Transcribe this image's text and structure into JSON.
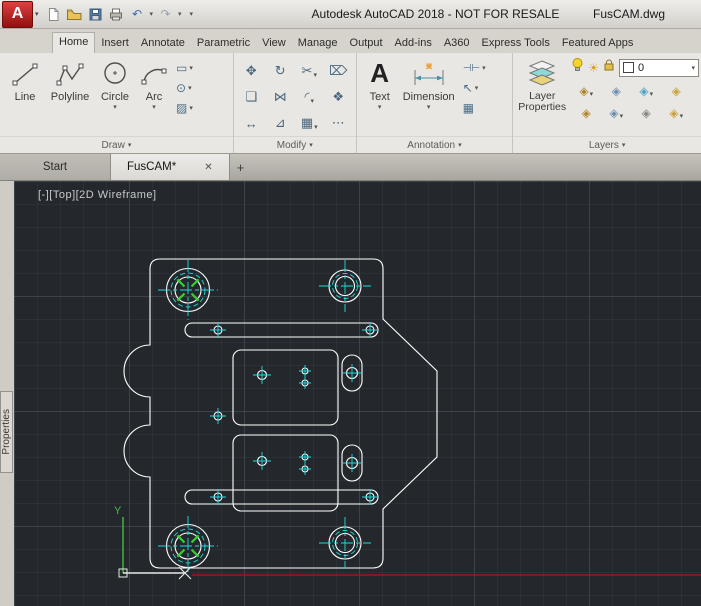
{
  "titlebar": {
    "title": "Autodesk AutoCAD 2018 - NOT FOR RESALE",
    "doc": "FusCAM.dwg",
    "logo_letter": "A"
  },
  "icons": {
    "chevron_down": "▾",
    "close": "✕",
    "sun": "☀",
    "undo": "↶",
    "redo": "↷",
    "text_tool_letter": "A",
    "rectangle_tool": "▭",
    "ellipse_tool": "⊙",
    "hatch_tool": "▨",
    "linear_dim_tool": "⊣⊢",
    "leader_tool": "↖",
    "table_tool": "▦"
  },
  "ribbon": {
    "tabs": [
      {
        "label": "Home",
        "active": true
      },
      {
        "label": "Insert"
      },
      {
        "label": "Annotate"
      },
      {
        "label": "Parametric"
      },
      {
        "label": "View"
      },
      {
        "label": "Manage"
      },
      {
        "label": "Output"
      },
      {
        "label": "Add-ins"
      },
      {
        "label": "A360"
      },
      {
        "label": "Express Tools"
      },
      {
        "label": "Featured Apps"
      }
    ],
    "draw": {
      "title": "Draw",
      "line_label": "Line",
      "polyline_label": "Polyline",
      "circle_label": "Circle",
      "arc_label": "Arc"
    },
    "modify": {
      "title": "Modify",
      "icons": [
        {
          "name": "move-icon",
          "glyph": "✥"
        },
        {
          "name": "rotate-icon",
          "glyph": "↻"
        },
        {
          "name": "trim-icon",
          "glyph": "✂"
        },
        {
          "name": "erase-icon",
          "glyph": "⌦"
        },
        {
          "name": "copy-icon",
          "glyph": "❏"
        },
        {
          "name": "mirror-icon",
          "glyph": "⋈"
        },
        {
          "name": "fillet-icon",
          "glyph": "◜"
        },
        {
          "name": "explode-icon",
          "glyph": "❖"
        },
        {
          "name": "stretch-icon",
          "glyph": "↔"
        },
        {
          "name": "scale-icon",
          "glyph": "⊿"
        },
        {
          "name": "array-icon",
          "glyph": "▦"
        },
        {
          "name": "more-icon",
          "glyph": "⋯"
        }
      ]
    },
    "annotation": {
      "title": "Annotation",
      "text_label": "Text",
      "dimension_label": "Dimension"
    },
    "layers": {
      "title": "Layers",
      "layer_properties_label": "Layer Properties",
      "current_layer": "0",
      "tool_icons": [
        {
          "name": "layer-off-icon",
          "glyph": "◈"
        },
        {
          "name": "layer-isolate-icon",
          "glyph": "◈"
        },
        {
          "name": "layer-freeze-icon",
          "glyph": "◈"
        },
        {
          "name": "layer-lock-icon",
          "glyph": "◈"
        },
        {
          "name": "layer-match-icon",
          "glyph": "◈"
        },
        {
          "name": "layer-current-icon",
          "glyph": "◈"
        },
        {
          "name": "layer-prev-icon",
          "glyph": "◈"
        },
        {
          "name": "layer-state-icon",
          "glyph": "◈"
        }
      ]
    }
  },
  "file_tabs": {
    "start_label": "Start",
    "doc_label": "FusCAM*",
    "new_tab_glyph": "+"
  },
  "viewport": {
    "controls_label": "[-][Top][2D Wireframe]"
  },
  "side_palette": {
    "label": "Properties"
  },
  "ucs": {
    "y_label": "Y"
  },
  "colors": {
    "canvas_bg": "#24282c",
    "geometry_white": "#ffffff",
    "center_mark_cyan": "#19dede",
    "hatch_green": "#2fd42f",
    "construction_red": "#b41414",
    "logo_red": "#b51a1a"
  }
}
